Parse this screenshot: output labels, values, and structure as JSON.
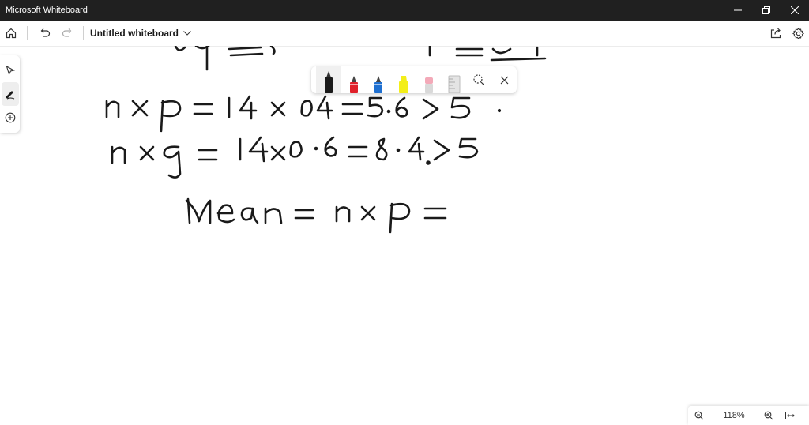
{
  "window": {
    "title": "Microsoft Whiteboard"
  },
  "toolbar": {
    "doc_title": "Untitled whiteboard",
    "icons": [
      "home-icon",
      "undo-icon",
      "redo-icon",
      "share-icon",
      "settings-icon"
    ]
  },
  "rail": {
    "tools": [
      "select-tool",
      "inking-tool",
      "create-tool"
    ],
    "active": "inking-tool"
  },
  "ink_toolbar": {
    "pens": [
      {
        "name": "black-pen",
        "color": "#1a1a1a"
      },
      {
        "name": "red-pen",
        "color": "#e0202a"
      },
      {
        "name": "blue-pen",
        "color": "#1e6fd0"
      },
      {
        "name": "yellow-highlighter",
        "color": "#f3ee1a"
      },
      {
        "name": "eraser",
        "color": "#f3a9b8"
      },
      {
        "name": "ruler",
        "color": "#cfcfcf"
      }
    ],
    "active_pen": "black-pen"
  },
  "canvas": {
    "ink_color": "#1a1a1a",
    "lines": [
      "n×p = 14×0.4 = 5.6 > 5",
      "n×q = 14×0.6 = 8.4 > 5",
      "Mean = n×p ="
    ]
  },
  "zoom": {
    "level": "118%"
  }
}
